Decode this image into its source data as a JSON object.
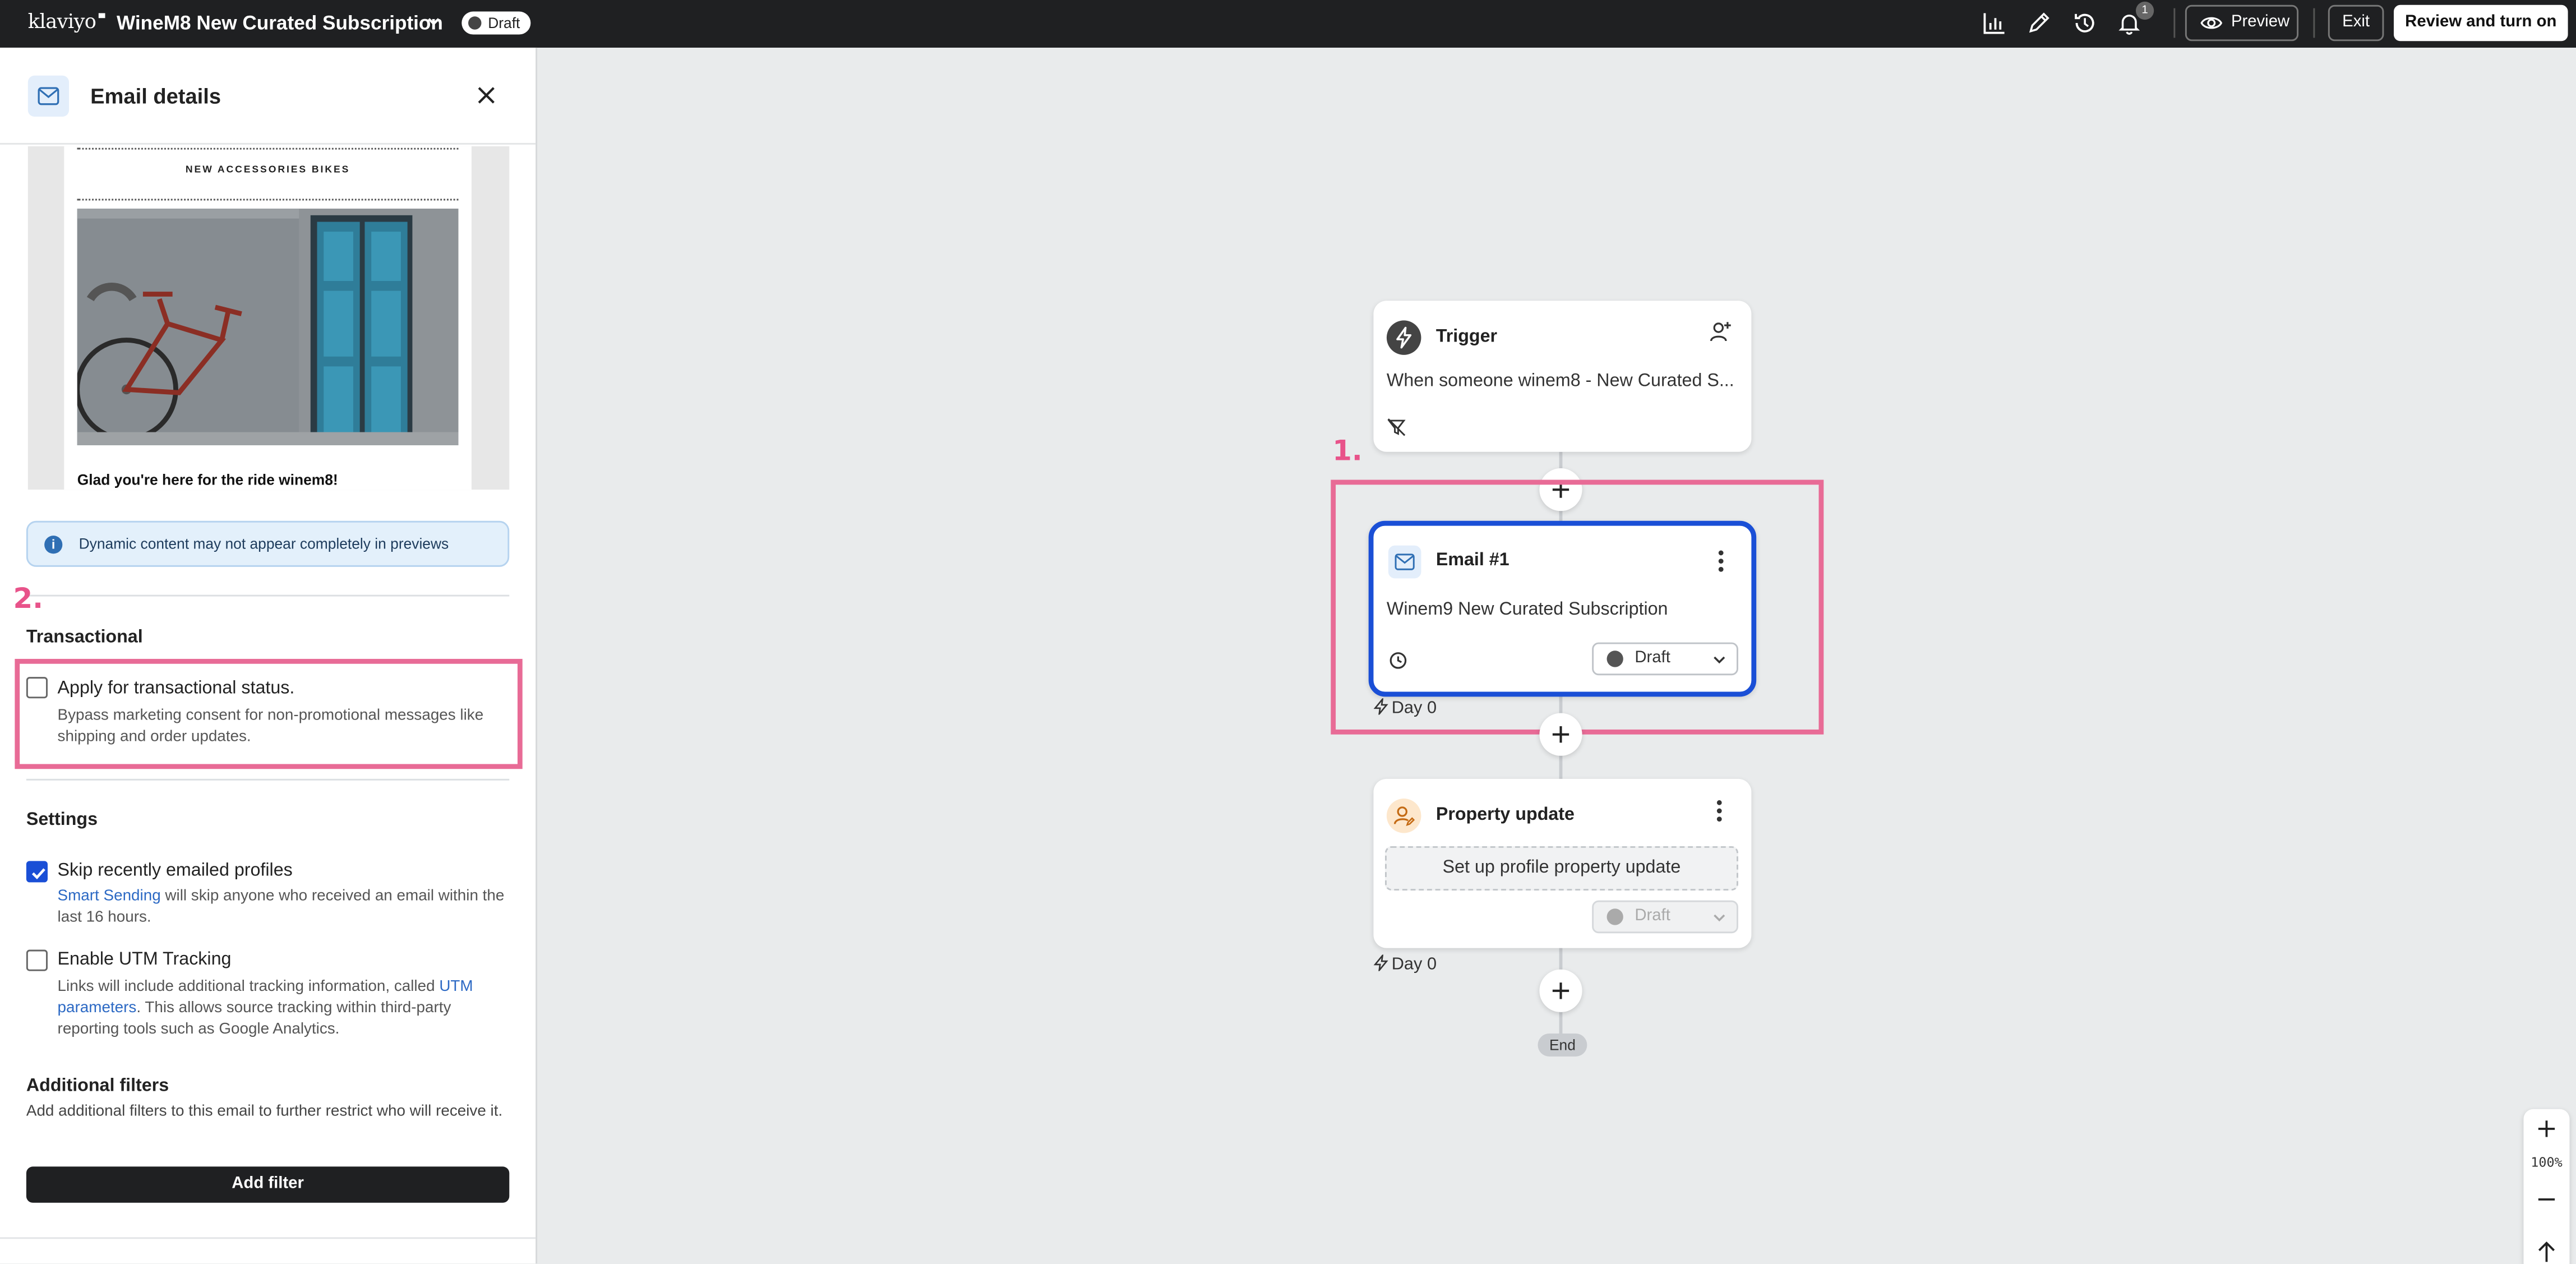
{
  "topbar": {
    "logo": "klaviyo",
    "flow_title": "WineM8 New Curated Subscription",
    "status_badge": "Draft",
    "notification_count": "1",
    "preview_label": "Preview",
    "exit_label": "Exit",
    "review_label": "Review and turn on"
  },
  "panel": {
    "title": "Email details",
    "email_preview": {
      "nav": "NEW   ACCESSORIES   BIKES",
      "greeting": "Glad you're here for the ride winem8!"
    },
    "info_message": "Dynamic content may not appear completely in previews",
    "annotation_2": "2.",
    "transactional": {
      "title": "Transactional",
      "checkbox_label": "Apply for transactional status.",
      "description": "Bypass marketing consent for non-promotional messages like shipping and order updates.",
      "checked": false
    },
    "settings": {
      "title": "Settings",
      "smart_sending": {
        "label": "Skip recently emailed profiles",
        "link": "Smart Sending",
        "description_rest": " will skip anyone who received an email within the last 16 hours.",
        "checked": true
      },
      "utm": {
        "label": "Enable UTM Tracking",
        "description_pre": "Links will include additional tracking information, called ",
        "link": "UTM parameters",
        "description_post": ". This allows source tracking within third-party reporting tools such as Google Analytics.",
        "checked": false
      }
    },
    "filters": {
      "title": "Additional filters",
      "description": "Add additional filters to this email to further restrict who will receive it.",
      "button": "Add filter"
    }
  },
  "canvas": {
    "annotation_1": "1.",
    "trigger": {
      "title": "Trigger",
      "description": "When someone winem8 - New Curated S..."
    },
    "email": {
      "title": "Email #1",
      "subject": "Winem9 New Curated Subscription",
      "status": "Draft",
      "delay": "Day 0"
    },
    "property_update": {
      "title": "Property update",
      "placeholder": "Set up profile property update",
      "status": "Draft",
      "delay": "Day 0"
    },
    "end_label": "End",
    "zoom": "100%"
  },
  "colors": {
    "topbar_bg": "#1f2022",
    "accent_blue": "#1a4fd6",
    "annotation_pink": "#e86b96",
    "canvas_bg": "#e9ebec"
  }
}
